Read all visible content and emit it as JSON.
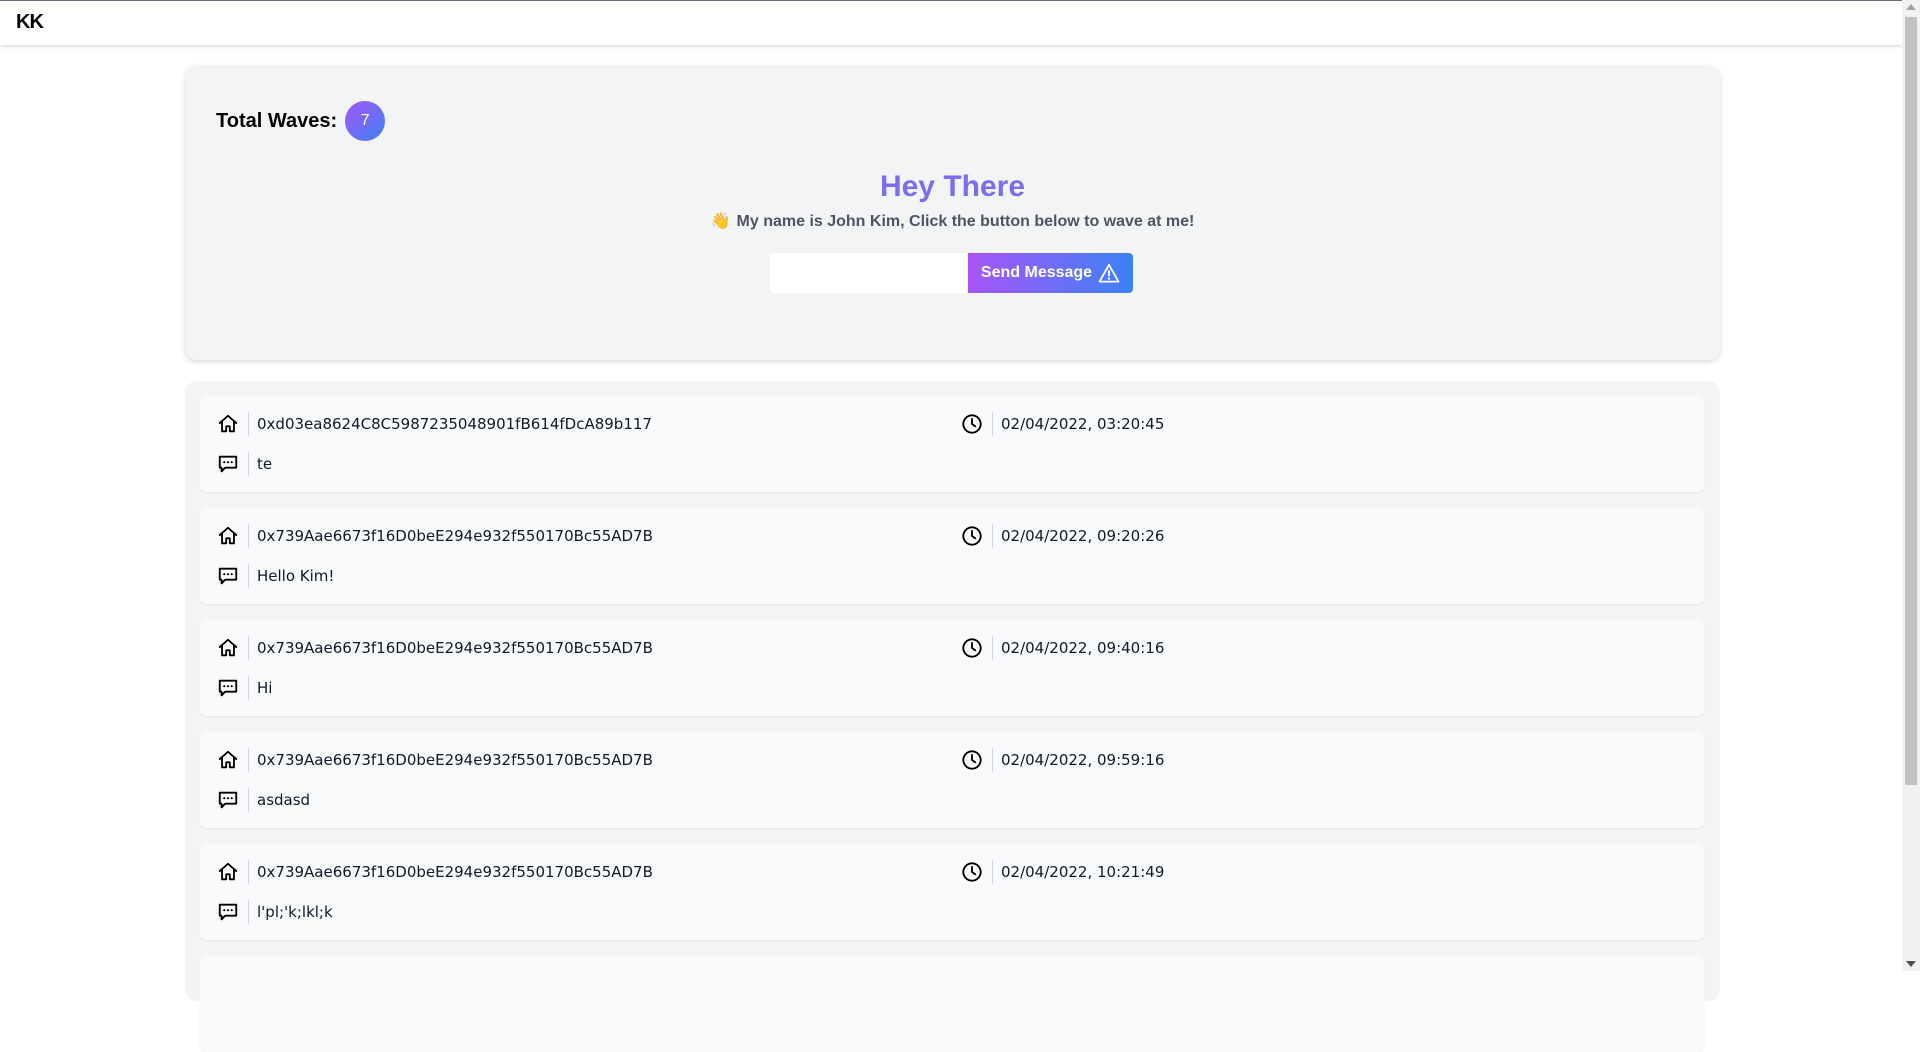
{
  "navbar": {
    "logo": "KK"
  },
  "hero": {
    "total_label": "Total Waves:",
    "total_count": "7",
    "title": "Hey There",
    "subtitle_icon": "waving-hand-icon",
    "subtitle": "My name is John Kim, Click the button below to wave at me!",
    "input_value": "",
    "send_label": "Send Message",
    "send_icon": "warning-triangle-icon"
  },
  "waves": [
    {
      "address": "0xd03ea8624C8C5987235048901fB614fDcA89b117",
      "time": "02/04/2022, 03:20:45",
      "message": "te"
    },
    {
      "address": "0x739Aae6673f16D0beE294e932f550170Bc55AD7B",
      "time": "02/04/2022, 09:20:26",
      "message": "Hello Kim!"
    },
    {
      "address": "0x739Aae6673f16D0beE294e932f550170Bc55AD7B",
      "time": "02/04/2022, 09:40:16",
      "message": "Hi"
    },
    {
      "address": "0x739Aae6673f16D0beE294e932f550170Bc55AD7B",
      "time": "02/04/2022, 09:59:16",
      "message": "asdasd"
    },
    {
      "address": "0x739Aae6673f16D0beE294e932f550170Bc55AD7B",
      "time": "02/04/2022, 10:21:49",
      "message": "l'pl;'k;lkl;k"
    }
  ],
  "icons": {
    "address": "home-icon",
    "time": "clock-icon",
    "message": "chat-icon"
  },
  "colors": {
    "accent_start": "#a855f7",
    "accent_end": "#3b82f6",
    "title": "#7c6cf0",
    "panel": "#f3f4f6"
  }
}
